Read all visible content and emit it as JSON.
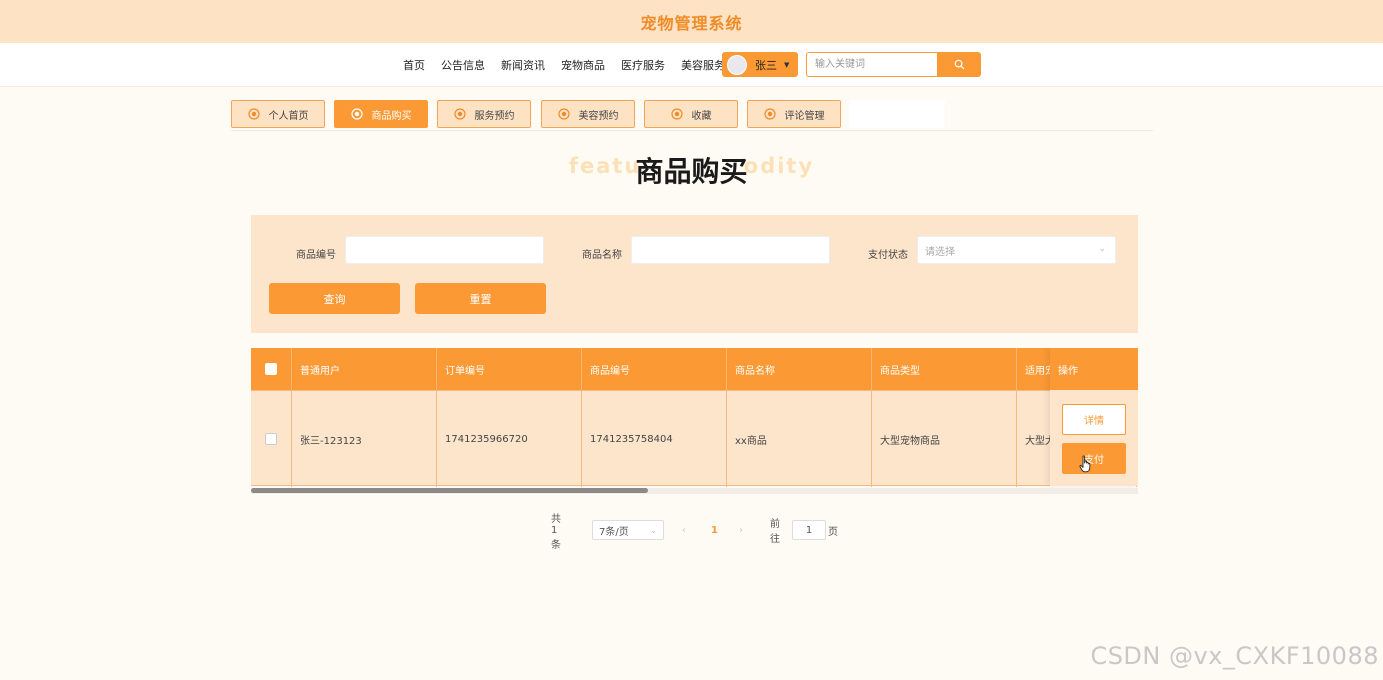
{
  "header": {
    "site_title": "宠物管理系统"
  },
  "nav": {
    "links": [
      "首页",
      "公告信息",
      "新闻资讯",
      "宠物商品",
      "医疗服务",
      "美容服务"
    ],
    "user_name": "张三",
    "search_placeholder": "输入关键词"
  },
  "tabs": [
    {
      "label": "个人首页",
      "active": false
    },
    {
      "label": "商品购买",
      "active": true
    },
    {
      "label": "服务预约",
      "active": false
    },
    {
      "label": "美容预约",
      "active": false
    },
    {
      "label": "收藏",
      "active": false
    },
    {
      "label": "评论管理",
      "active": false
    }
  ],
  "page_heading": {
    "title": "商品购买",
    "background_text": "featu           odity"
  },
  "filters": {
    "product_code_label": "商品编号",
    "product_name_label": "商品名称",
    "pay_status_label": "支付状态",
    "pay_status_placeholder": "请选择",
    "search_button": "查询",
    "reset_button": "重置"
  },
  "table": {
    "columns": [
      "普通用户",
      "订单编号",
      "商品编号",
      "商品名称",
      "商品类型",
      "适用宠"
    ],
    "operation_column": "操作",
    "rows": [
      {
        "user": "张三-123123",
        "order_no": "1741235966720",
        "product_code": "1741235758404",
        "product_name": "xx商品",
        "product_type": "大型宠物商品",
        "applicable_pet": "大型犬"
      }
    ],
    "detail_button": "详情",
    "pay_button": "支付"
  },
  "pagination": {
    "total": "共 1 条",
    "page_size": "7条/页",
    "current_page": "1",
    "goto_label": "前往",
    "goto_value": "1",
    "page_suffix": "页"
  },
  "watermark": "CSDN @vx_CXKF10088",
  "colors": {
    "accent": "#fb9a35",
    "banner": "#fde2c4",
    "panel": "#fde5cc"
  }
}
